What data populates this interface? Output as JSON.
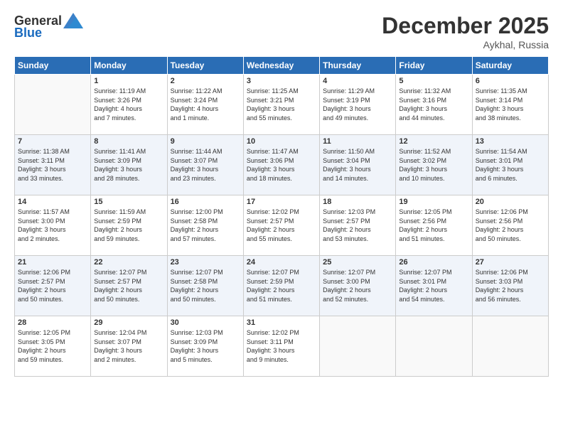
{
  "header": {
    "logo": {
      "general": "General",
      "blue": "Blue"
    },
    "title": "December 2025",
    "location": "Aykhal, Russia"
  },
  "weekdays": [
    "Sunday",
    "Monday",
    "Tuesday",
    "Wednesday",
    "Thursday",
    "Friday",
    "Saturday"
  ],
  "weeks": [
    [
      {
        "day": "",
        "info": ""
      },
      {
        "day": "1",
        "info": "Sunrise: 11:19 AM\nSunset: 3:26 PM\nDaylight: 4 hours\nand 7 minutes."
      },
      {
        "day": "2",
        "info": "Sunrise: 11:22 AM\nSunset: 3:24 PM\nDaylight: 4 hours\nand 1 minute."
      },
      {
        "day": "3",
        "info": "Sunrise: 11:25 AM\nSunset: 3:21 PM\nDaylight: 3 hours\nand 55 minutes."
      },
      {
        "day": "4",
        "info": "Sunrise: 11:29 AM\nSunset: 3:19 PM\nDaylight: 3 hours\nand 49 minutes."
      },
      {
        "day": "5",
        "info": "Sunrise: 11:32 AM\nSunset: 3:16 PM\nDaylight: 3 hours\nand 44 minutes."
      },
      {
        "day": "6",
        "info": "Sunrise: 11:35 AM\nSunset: 3:14 PM\nDaylight: 3 hours\nand 38 minutes."
      }
    ],
    [
      {
        "day": "7",
        "info": "Sunrise: 11:38 AM\nSunset: 3:11 PM\nDaylight: 3 hours\nand 33 minutes."
      },
      {
        "day": "8",
        "info": "Sunrise: 11:41 AM\nSunset: 3:09 PM\nDaylight: 3 hours\nand 28 minutes."
      },
      {
        "day": "9",
        "info": "Sunrise: 11:44 AM\nSunset: 3:07 PM\nDaylight: 3 hours\nand 23 minutes."
      },
      {
        "day": "10",
        "info": "Sunrise: 11:47 AM\nSunset: 3:06 PM\nDaylight: 3 hours\nand 18 minutes."
      },
      {
        "day": "11",
        "info": "Sunrise: 11:50 AM\nSunset: 3:04 PM\nDaylight: 3 hours\nand 14 minutes."
      },
      {
        "day": "12",
        "info": "Sunrise: 11:52 AM\nSunset: 3:02 PM\nDaylight: 3 hours\nand 10 minutes."
      },
      {
        "day": "13",
        "info": "Sunrise: 11:54 AM\nSunset: 3:01 PM\nDaylight: 3 hours\nand 6 minutes."
      }
    ],
    [
      {
        "day": "14",
        "info": "Sunrise: 11:57 AM\nSunset: 3:00 PM\nDaylight: 3 hours\nand 2 minutes."
      },
      {
        "day": "15",
        "info": "Sunrise: 11:59 AM\nSunset: 2:59 PM\nDaylight: 2 hours\nand 59 minutes."
      },
      {
        "day": "16",
        "info": "Sunrise: 12:00 PM\nSunset: 2:58 PM\nDaylight: 2 hours\nand 57 minutes."
      },
      {
        "day": "17",
        "info": "Sunrise: 12:02 PM\nSunset: 2:57 PM\nDaylight: 2 hours\nand 55 minutes."
      },
      {
        "day": "18",
        "info": "Sunrise: 12:03 PM\nSunset: 2:57 PM\nDaylight: 2 hours\nand 53 minutes."
      },
      {
        "day": "19",
        "info": "Sunrise: 12:05 PM\nSunset: 2:56 PM\nDaylight: 2 hours\nand 51 minutes."
      },
      {
        "day": "20",
        "info": "Sunrise: 12:06 PM\nSunset: 2:56 PM\nDaylight: 2 hours\nand 50 minutes."
      }
    ],
    [
      {
        "day": "21",
        "info": "Sunrise: 12:06 PM\nSunset: 2:57 PM\nDaylight: 2 hours\nand 50 minutes."
      },
      {
        "day": "22",
        "info": "Sunrise: 12:07 PM\nSunset: 2:57 PM\nDaylight: 2 hours\nand 50 minutes."
      },
      {
        "day": "23",
        "info": "Sunrise: 12:07 PM\nSunset: 2:58 PM\nDaylight: 2 hours\nand 50 minutes."
      },
      {
        "day": "24",
        "info": "Sunrise: 12:07 PM\nSunset: 2:59 PM\nDaylight: 2 hours\nand 51 minutes."
      },
      {
        "day": "25",
        "info": "Sunrise: 12:07 PM\nSunset: 3:00 PM\nDaylight: 2 hours\nand 52 minutes."
      },
      {
        "day": "26",
        "info": "Sunrise: 12:07 PM\nSunset: 3:01 PM\nDaylight: 2 hours\nand 54 minutes."
      },
      {
        "day": "27",
        "info": "Sunrise: 12:06 PM\nSunset: 3:03 PM\nDaylight: 2 hours\nand 56 minutes."
      }
    ],
    [
      {
        "day": "28",
        "info": "Sunrise: 12:05 PM\nSunset: 3:05 PM\nDaylight: 2 hours\nand 59 minutes."
      },
      {
        "day": "29",
        "info": "Sunrise: 12:04 PM\nSunset: 3:07 PM\nDaylight: 3 hours\nand 2 minutes."
      },
      {
        "day": "30",
        "info": "Sunrise: 12:03 PM\nSunset: 3:09 PM\nDaylight: 3 hours\nand 5 minutes."
      },
      {
        "day": "31",
        "info": "Sunrise: 12:02 PM\nSunset: 3:11 PM\nDaylight: 3 hours\nand 9 minutes."
      },
      {
        "day": "",
        "info": ""
      },
      {
        "day": "",
        "info": ""
      },
      {
        "day": "",
        "info": ""
      }
    ]
  ]
}
